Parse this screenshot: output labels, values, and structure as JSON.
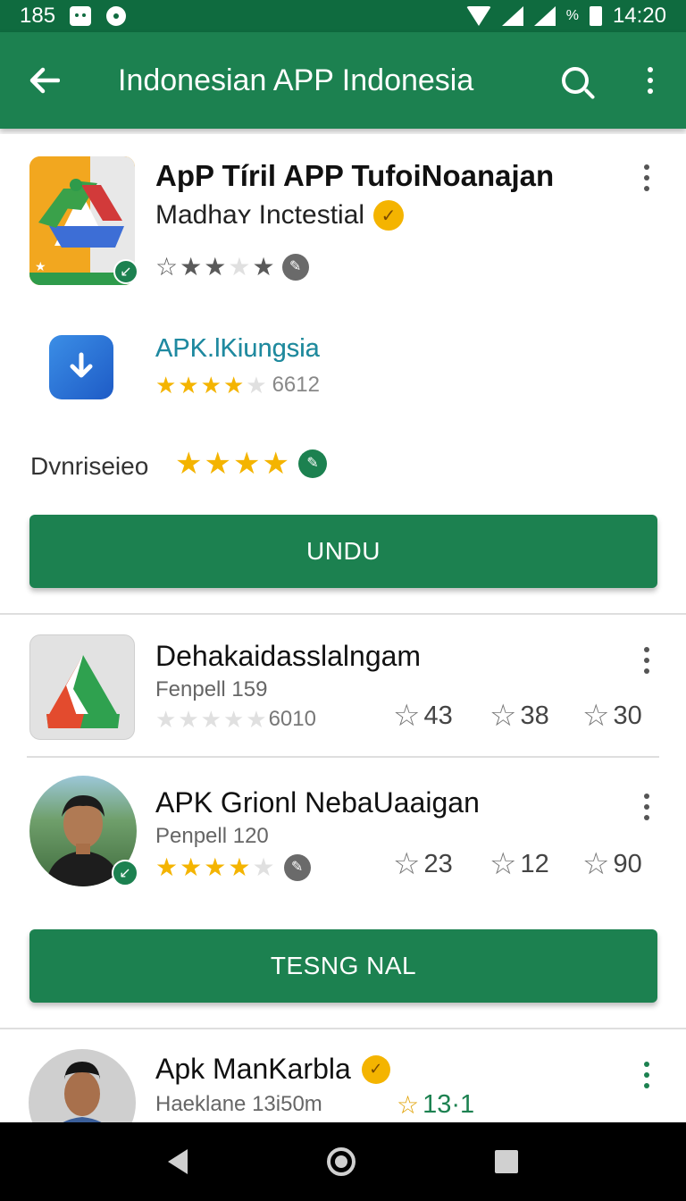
{
  "status_bar": {
    "left_text": "185",
    "time": "14:20",
    "battery_text": "%"
  },
  "app_bar": {
    "title": "Indonesian APP Indonesia",
    "back_icon": "arrow-left-icon",
    "search_icon": "search-icon",
    "menu_icon": "more-vert-icon",
    "color": "#1c8150"
  },
  "featured": {
    "app1": {
      "title": "ApP Tíril APP TufoiNoanajan",
      "subtitle": "Madhaʏ Inctestial",
      "rating_stars": 3
    },
    "app2": {
      "name": "APK.lKiungsia",
      "rating_stars": 3.5,
      "count": "6612"
    },
    "row": {
      "label": "Dvnriseieo",
      "rating_stars": 4
    },
    "button": "UNDU"
  },
  "list": [
    {
      "title": "Dehakaidasslalngam",
      "meta": "Fenpell 159",
      "count": "6010",
      "rating_stars": 0,
      "stats": [
        "43",
        "38",
        "30"
      ]
    },
    {
      "title": "APK Grionl NebaUaaigan",
      "meta": "Penpell 120",
      "rating_stars": 3.5,
      "stats": [
        "23",
        "12",
        "90"
      ]
    }
  ],
  "button2": "TESNG NAL",
  "last_item": {
    "title": "Apk ManKarbla",
    "meta": "Haeklane 13i50m",
    "stat": "13·1"
  },
  "colors": {
    "accent": "#1c8150",
    "star": "#f4b400",
    "status_bar": "#0f6b3f"
  }
}
